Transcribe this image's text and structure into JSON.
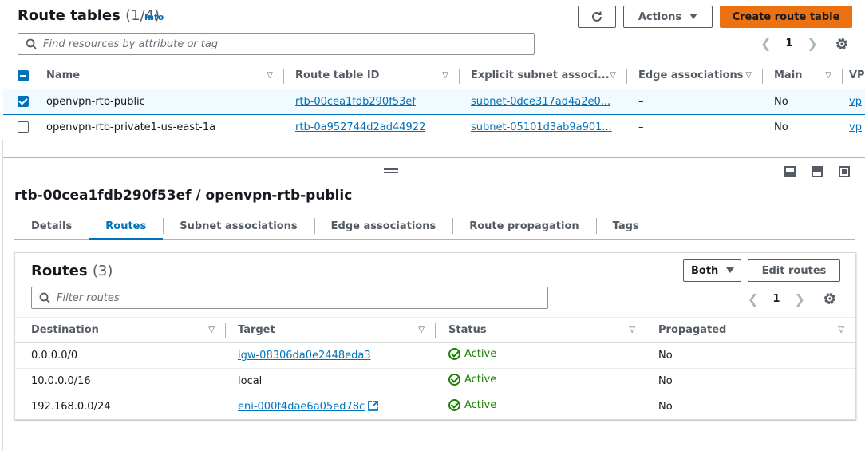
{
  "header": {
    "title": "Route tables",
    "count": "(1/4)",
    "info": "Info",
    "actions_label": "Actions",
    "create_label": "Create route table",
    "search_placeholder": "Find resources by attribute or tag",
    "page": "1"
  },
  "route_tables": {
    "columns": [
      "Name",
      "Route table ID",
      "Explicit subnet associ...",
      "Edge associations",
      "Main",
      "VP"
    ],
    "rows": [
      {
        "selected": true,
        "name": "openvpn-rtb-public",
        "id": "rtb-00cea1fdb290f53ef",
        "subnet": "subnet-0dce317ad4a2e0...",
        "edge": "–",
        "main": "No",
        "vpc": "vp"
      },
      {
        "selected": false,
        "name": "openvpn-rtb-private1-us-east-1a",
        "id": "rtb-0a952744d2ad44922",
        "subnet": "subnet-05101d3ab9a901...",
        "edge": "–",
        "main": "No",
        "vpc": "vp"
      }
    ]
  },
  "detail": {
    "title": "rtb-00cea1fdb290f53ef / openvpn-rtb-public",
    "tabs": [
      "Details",
      "Routes",
      "Subnet associations",
      "Edge associations",
      "Route propagation",
      "Tags"
    ],
    "active_tab": "Routes"
  },
  "routes": {
    "title": "Routes",
    "count": "(3)",
    "filter_label": "Both",
    "edit_label": "Edit routes",
    "search_placeholder": "Filter routes",
    "page": "1",
    "columns": [
      "Destination",
      "Target",
      "Status",
      "Propagated"
    ],
    "rows": [
      {
        "destination": "0.0.0.0/0",
        "target": "igw-08306da0e2448eda3",
        "status": "Active",
        "propagated": "No"
      },
      {
        "destination": "10.0.0.0/16",
        "target": "local",
        "status": "Active",
        "propagated": "No"
      },
      {
        "destination": "192.168.0.0/24",
        "target": "eni-000f4dae6a05ed78c",
        "status": "Active",
        "propagated": "No"
      }
    ]
  },
  "colors": {
    "primary_button": "#ec7211",
    "link": "#0073bb",
    "status_ok": "#1d8102",
    "selected_row_bg": "#f1faff"
  },
  "icons": [
    "refresh-icon",
    "caret-down-icon",
    "search-icon",
    "chevron-left-icon",
    "chevron-right-icon",
    "gear-icon",
    "drag-handle-icon",
    "panel-bottom-icon",
    "panel-side-icon",
    "panel-hide-icon",
    "status-check-icon",
    "external-link-icon"
  ]
}
